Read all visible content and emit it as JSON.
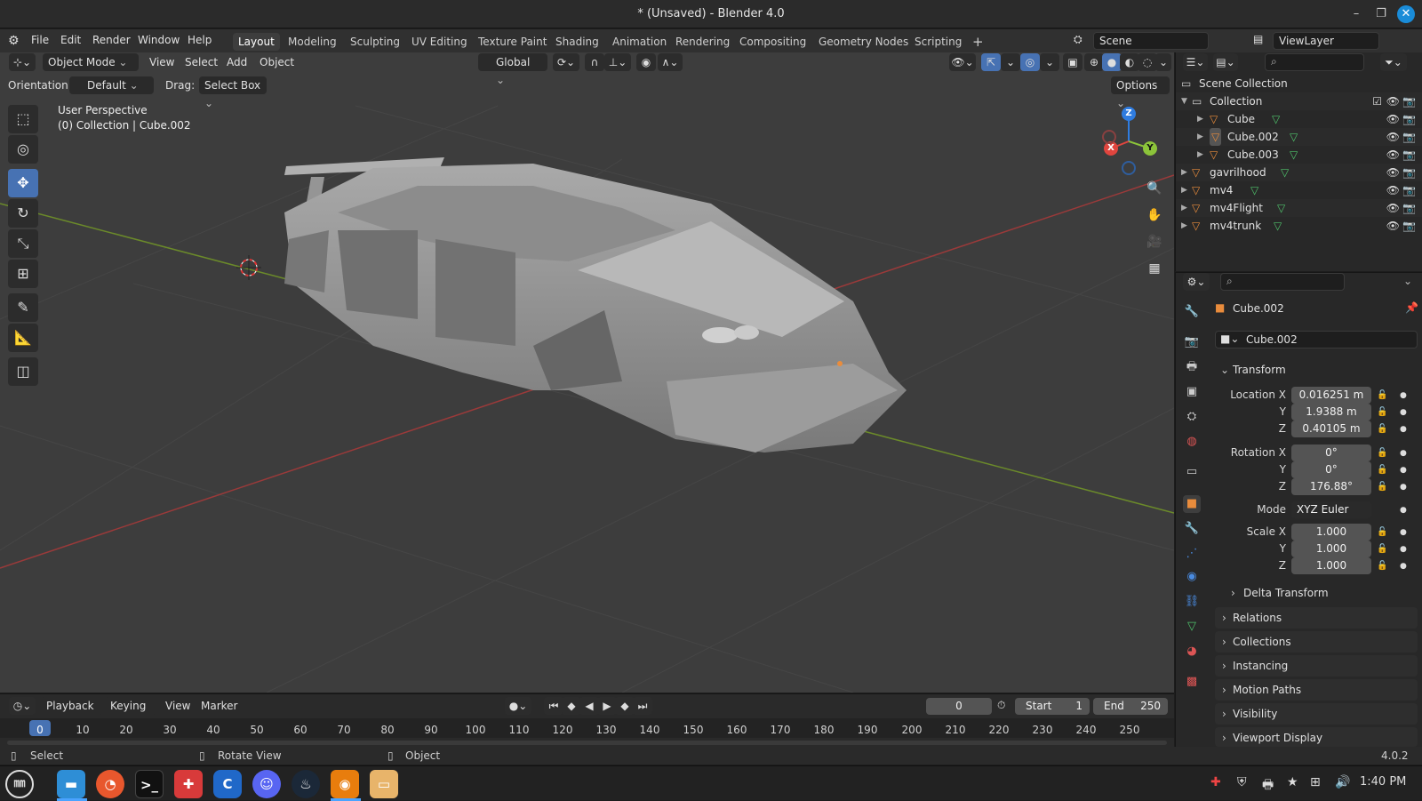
{
  "window": {
    "title": "* (Unsaved) - Blender 4.0",
    "minimize": "–",
    "maximize": "❐",
    "close": "✕"
  },
  "menu": {
    "file": "File",
    "edit": "Edit",
    "render": "Render",
    "window": "Window",
    "help": "Help"
  },
  "workspaces": [
    "Layout",
    "Modeling",
    "Sculpting",
    "UV Editing",
    "Texture Paint",
    "Shading",
    "Animation",
    "Rendering",
    "Compositing",
    "Geometry Nodes",
    "Scripting"
  ],
  "add_workspace": "+",
  "scene": {
    "name": "Scene",
    "view_layer": "ViewLayer"
  },
  "viewport_header": {
    "mode": "Object Mode",
    "view": "View",
    "select": "Select",
    "add": "Add",
    "object": "Object",
    "transform_orientation": "Global"
  },
  "tool_settings": {
    "orientation_label": "Orientation:",
    "orientation_value": "Default",
    "drag_label": "Drag:",
    "drag_value": "Select Box",
    "options": "Options"
  },
  "viewport_info": {
    "perspective": "User Perspective",
    "collection": "(0) Collection | Cube.002"
  },
  "gizmo": {
    "x": "X",
    "y": "Y",
    "z": "Z"
  },
  "colors": {
    "accent": "#4772b3",
    "selected_orange": "#e98c3c",
    "data_green": "#4fc26b",
    "axis_x": "#e0453e",
    "axis_y": "#8cc43a",
    "axis_z": "#2f7ce0"
  },
  "outliner": {
    "root": "Scene Collection",
    "collection": "Collection",
    "items": [
      {
        "label": "Cube"
      },
      {
        "label": "Cube.002"
      },
      {
        "label": "Cube.003"
      }
    ],
    "top_items": [
      {
        "label": "gavrilhood"
      },
      {
        "label": "mv4"
      },
      {
        "label": "mv4Flight"
      },
      {
        "label": "mv4trunk"
      }
    ]
  },
  "properties": {
    "object_name": "Cube.002",
    "object_field": "Cube.002",
    "transform_title": "Transform",
    "location_label": "Location X",
    "location": {
      "x": "0.016251 m",
      "y": "1.9388 m",
      "z": "0.40105 m"
    },
    "rotation_label": "Rotation X",
    "rotation": {
      "x": "0°",
      "y": "0°",
      "z": "176.88°"
    },
    "mode_label": "Mode",
    "mode_value": "XYZ Euler",
    "scale_label": "Scale X",
    "scale": {
      "x": "1.000",
      "y": "1.000",
      "z": "1.000"
    },
    "y_label": "Y",
    "z_label": "Z",
    "delta_transform": "Delta Transform",
    "panels": [
      "Relations",
      "Collections",
      "Instancing",
      "Motion Paths",
      "Visibility",
      "Viewport Display"
    ]
  },
  "timeline": {
    "playback": "Playback",
    "keying": "Keying",
    "view": "View",
    "marker": "Marker",
    "current_frame": "0",
    "start_label": "Start",
    "start": "1",
    "end_label": "End",
    "end": "250",
    "frames": [
      "0",
      "10",
      "20",
      "30",
      "40",
      "50",
      "60",
      "70",
      "80",
      "90",
      "100",
      "110",
      "120",
      "130",
      "140",
      "150",
      "160",
      "170",
      "180",
      "190",
      "200",
      "210",
      "220",
      "230",
      "240",
      "250"
    ]
  },
  "statusbar": {
    "select": "Select",
    "rotate": "Rotate View",
    "object": "Object",
    "version": "4.0.2"
  },
  "taskbar": {
    "clock": "1:40 PM",
    "apps": [
      "menu",
      "files",
      "firefox",
      "terminal",
      "game",
      "code",
      "discord",
      "steam",
      "blender",
      "archive"
    ]
  }
}
